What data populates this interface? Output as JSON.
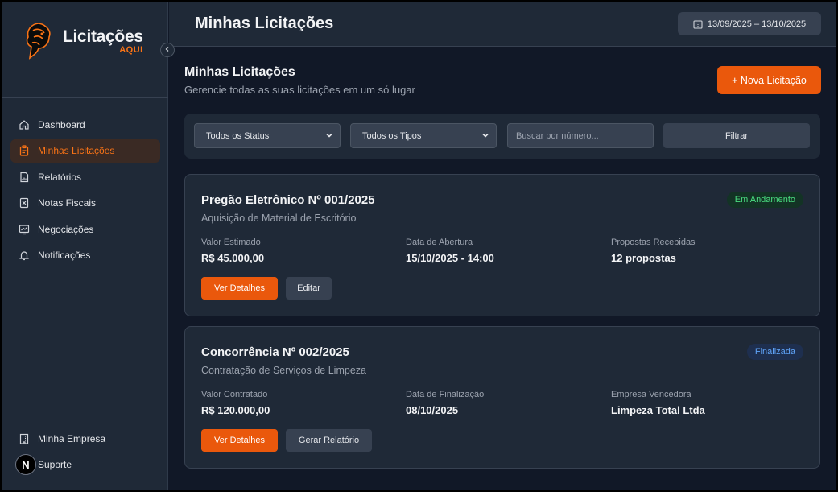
{
  "brand": {
    "title": "Licitações",
    "subtitle": "AQUI",
    "accent": "#f97316"
  },
  "sidebar": {
    "collapse_icon": "chevron-left-icon",
    "items": [
      {
        "label": "Dashboard",
        "icon": "home-icon",
        "active": false
      },
      {
        "label": "Minhas Licitações",
        "icon": "clipboard-icon",
        "active": true
      },
      {
        "label": "Relatórios",
        "icon": "report-icon",
        "active": false
      },
      {
        "label": "Notas Fiscais",
        "icon": "invoice-icon",
        "active": false
      },
      {
        "label": "Negociações",
        "icon": "chart-icon",
        "active": false
      },
      {
        "label": "Notificações",
        "icon": "bell-icon",
        "active": false
      }
    ],
    "bottom_items": [
      {
        "label": "Minha Empresa",
        "icon": "building-icon"
      },
      {
        "label": "Suporte",
        "icon": "support-icon"
      }
    ],
    "avatar_letter": "N"
  },
  "topbar": {
    "title": "Minhas Licitações",
    "date_range": "13/09/2025 – 13/10/2025",
    "date_icon": "calendar-icon"
  },
  "page": {
    "title": "Minhas Licitações",
    "subtitle": "Gerencie todas as suas licitações em um só lugar",
    "new_button": "+ Nova Licitação"
  },
  "filters": {
    "status": {
      "selected": "Todos os Status"
    },
    "type": {
      "selected": "Todos os Tipos"
    },
    "search": {
      "placeholder": "Buscar por número..."
    },
    "filter_button": "Filtrar"
  },
  "cards": [
    {
      "title": "Pregão Eletrônico Nº 001/2025",
      "subtitle": "Aquisição de Material de Escritório",
      "status": "Em Andamento",
      "status_color": "#4ade80",
      "fields": [
        {
          "label": "Valor Estimado",
          "value": "R$ 45.000,00"
        },
        {
          "label": "Data de Abertura",
          "value": "15/10/2025 - 14:00"
        },
        {
          "label": "Propostas Recebidas",
          "value": "12 propostas"
        }
      ],
      "primary_action": "Ver Detalhes",
      "secondary_action": "Editar"
    },
    {
      "title": "Concorrência Nº 002/2025",
      "subtitle": "Contratação de Serviços de Limpeza",
      "status": "Finalizada",
      "status_color": "#60a5fa",
      "fields": [
        {
          "label": "Valor Contratado",
          "value": "R$ 120.000,00"
        },
        {
          "label": "Data de Finalização",
          "value": "08/10/2025"
        },
        {
          "label": "Empresa Vencedora",
          "value": "Limpeza Total Ltda"
        }
      ],
      "primary_action": "Ver Detalhes",
      "secondary_action": "Gerar Relatório"
    }
  ]
}
